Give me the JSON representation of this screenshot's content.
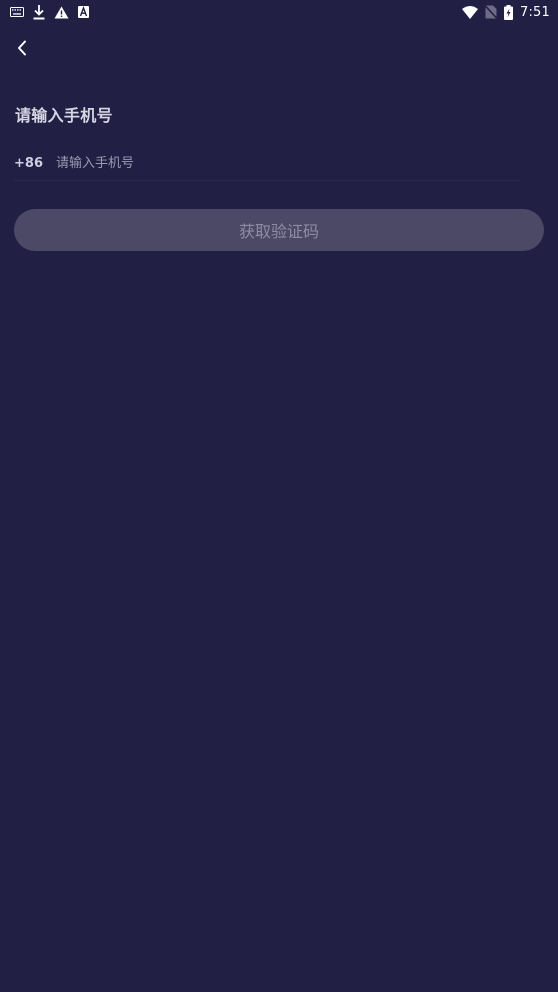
{
  "status_bar": {
    "time": "7:51",
    "left_icons": [
      "keyboard-icon",
      "download-icon",
      "warning-icon",
      "a-badge-icon"
    ],
    "right_icons": [
      "wifi-icon",
      "no-sim-icon",
      "battery-charging-icon"
    ]
  },
  "nav": {
    "back_icon": "chevron-left-icon"
  },
  "login": {
    "title": "请输入手机号",
    "country_code": "+86",
    "phone_placeholder": "请输入手机号",
    "phone_value": "",
    "get_code_label": "获取验证码"
  },
  "colors": {
    "background": "#211f43",
    "button_disabled_bg": "#4b4965",
    "button_disabled_text": "#8f8da4",
    "title_text": "#d6d5e3",
    "placeholder_text": "#9c9ab3"
  }
}
